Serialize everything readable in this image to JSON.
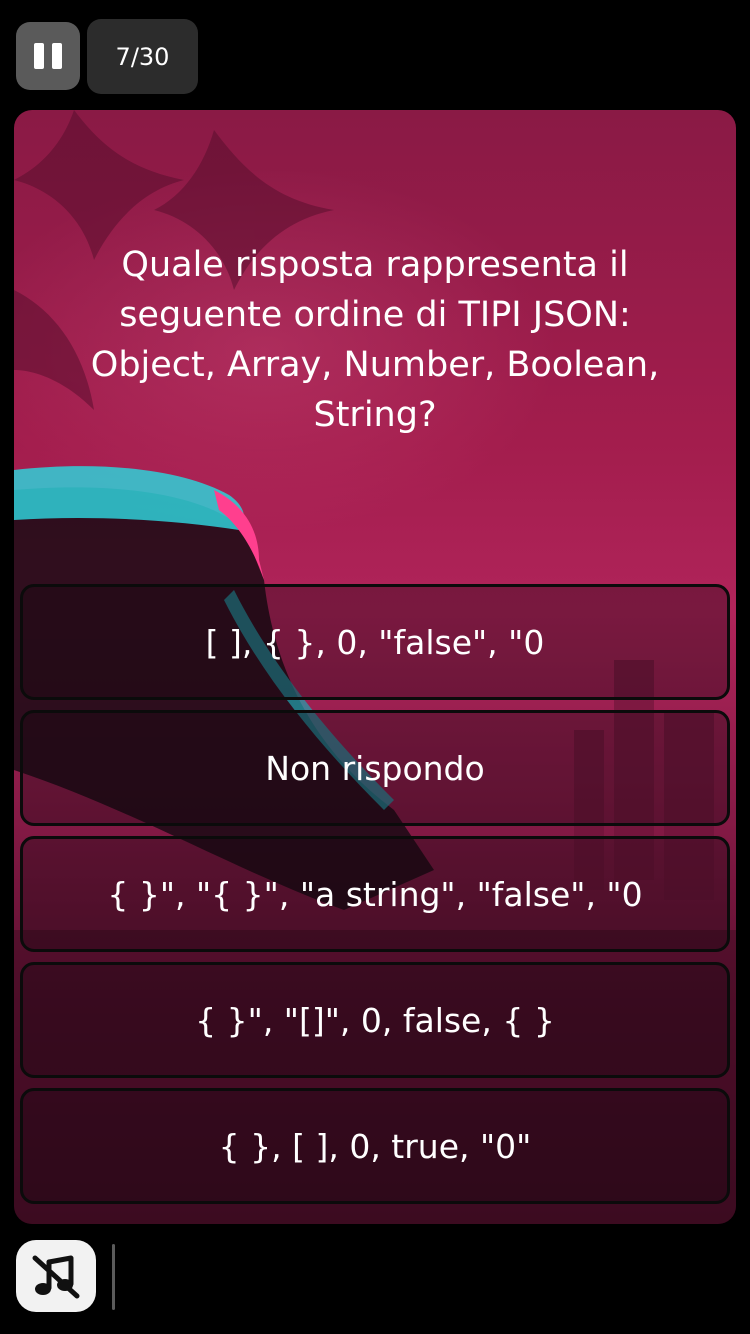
{
  "header": {
    "progress_label": "7/30"
  },
  "quiz": {
    "question": "Quale risposta rappresenta il seguente ordine di TIPI JSON: Object, Array, Number, Boolean, String?",
    "answers": [
      {
        "label": "[ ], { }, 0, \"false\", \"0"
      },
      {
        "label": "Non rispondo"
      },
      {
        "label": "{ }\", \"{ }\", \"a string\", \"false\", \"0"
      },
      {
        "label": "{ }\", \"[]\", 0, false, { }"
      },
      {
        "label": "{ }, [ ], 0, true, \"0\""
      }
    ]
  },
  "icons": {
    "pause": "pause-icon",
    "sound": "music-off-icon"
  },
  "colors": {
    "card_top": "#8a1a45",
    "card_mid": "#b0245a",
    "card_bottom": "#3e0b22",
    "accent_cyan": "#2fd0d8",
    "accent_pink": "#ff3f8e"
  }
}
